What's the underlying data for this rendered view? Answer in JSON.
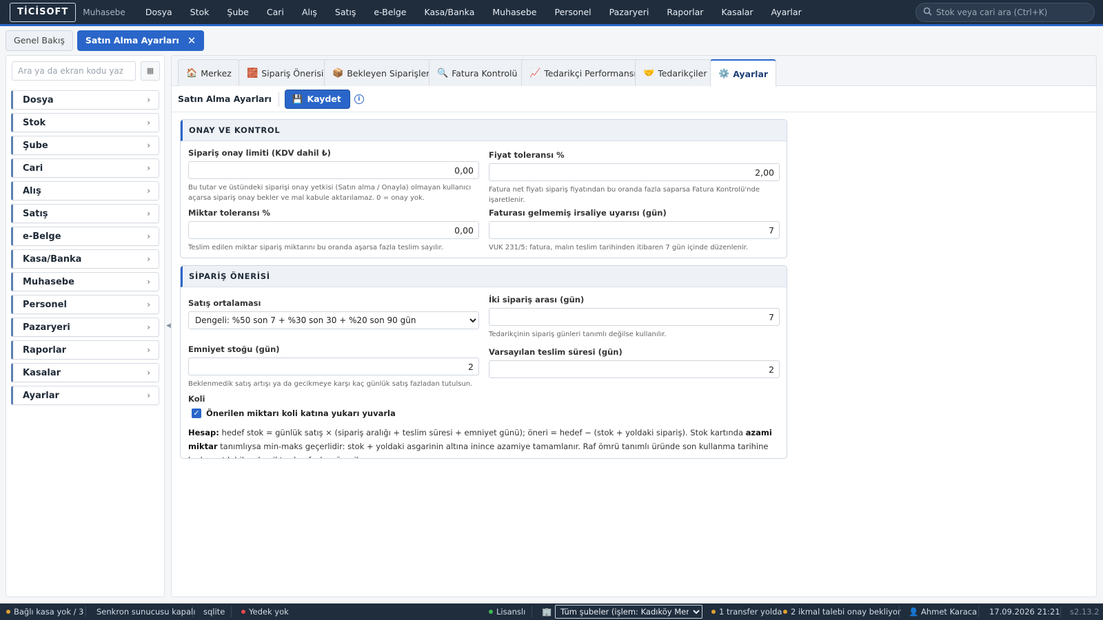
{
  "app": {
    "logo": "TİCİSOFT",
    "module": "Muhasebe"
  },
  "topmenu": [
    "Dosya",
    "Stok",
    "Şube",
    "Cari",
    "Alış",
    "Satış",
    "e-Belge",
    "Kasa/Banka",
    "Muhasebe",
    "Personel",
    "Pazaryeri",
    "Raporlar",
    "Kasalar",
    "Ayarlar"
  ],
  "topsearch": {
    "placeholder": "Stok veya cari ara (Ctrl+K)"
  },
  "page_tabs": {
    "overview": "Genel Bakış",
    "active": "Satın Alma Ayarları"
  },
  "sidebar": {
    "search_placeholder": "Ara ya da ekran kodu yaz",
    "items": [
      "Dosya",
      "Stok",
      "Şube",
      "Cari",
      "Alış",
      "Satış",
      "e-Belge",
      "Kasa/Banka",
      "Muhasebe",
      "Personel",
      "Pazaryeri",
      "Raporlar",
      "Kasalar",
      "Ayarlar"
    ]
  },
  "module_tabs": [
    {
      "label": "Merkez",
      "icon": "home-icon"
    },
    {
      "label": "Sipariş Önerisi",
      "icon": "bricks-icon"
    },
    {
      "label": "Bekleyen Siparişler",
      "icon": "package-icon"
    },
    {
      "label": "Fatura Kontrolü",
      "icon": "magnifier-icon"
    },
    {
      "label": "Tedarikçi Performansı",
      "icon": "chart-icon"
    },
    {
      "label": "Tedarikçiler",
      "icon": "handshake-icon"
    },
    {
      "label": "Ayarlar",
      "icon": "gear-icon"
    }
  ],
  "toolbar": {
    "title": "Satın Alma Ayarları",
    "save_label": "Kaydet"
  },
  "approval": {
    "title": "ONAY VE KONTROL",
    "limit_label": "Sipariş onay limiti (KDV dahil ₺)",
    "limit_value": "0,00",
    "limit_hint": "Bu tutar ve üstündeki siparişi onay yetkisi (Satın alma / Onayla) olmayan kullanıcı açarsa sipariş onay bekler ve mal kabule aktarılamaz. 0 = onay yok.",
    "price_tol_label": "Fiyat toleransı %",
    "price_tol_value": "2,00",
    "price_tol_hint": "Fatura net fiyatı sipariş fiyatından bu oranda fazla saparsa Fatura Kontrolü'nde işaretlenir.",
    "qty_tol_label": "Miktar toleransı %",
    "qty_tol_value": "0,00",
    "qty_tol_hint": "Teslim edilen miktar sipariş miktarını bu oranda aşarsa fazla teslim sayılır.",
    "waybill_label": "Faturası gelmemiş irsaliye uyarısı (gün)",
    "waybill_value": "7",
    "waybill_hint": "VUK 231/5: fatura, malın teslim tarihinden itibaren 7 gün içinde düzenlenir."
  },
  "suggestion": {
    "title": "SİPARİŞ ÖNERİSİ",
    "avg_label": "Satış ortalaması",
    "avg_value": "Dengeli: %50 son 7 + %30 son 30 + %20 son 90 gün",
    "interval_label": "İki sipariş arası (gün)",
    "interval_value": "7",
    "interval_hint": "Tedarikçinin sipariş günleri tanımlı değilse kullanılır.",
    "safety_label": "Emniyet stoğu (gün)",
    "safety_value": "2",
    "safety_hint": "Beklenmedik satış artışı ya da gecikmeye karşı kaç günlük satış fazladan tutulsun.",
    "lead_label": "Varsayılan teslim süresi (gün)",
    "lead_value": "2",
    "koli_label": "Koli",
    "koli_checkbox": "Önerilen miktarı koli katına yukarı yuvarla",
    "koli_checked": true,
    "note_bold1": "Hesap:",
    "note_text1": " hedef stok = günlük satış × (sipariş aralığı + teslim süresi + emniyet günü); öneri = hedef − (stok + yoldaki sipariş). Stok kartında ",
    "note_bold2": "azami miktar",
    "note_text2": " tanımlıysa min-maks geçerlidir: stok + yoldaki asgarinin altına inince azamiye tamamlanır. Raf ömrü tanımlı üründe son kullanma tarihine kadar satılabilecek miktardan fazlası önerilmez."
  },
  "statusbar": {
    "cash": "Bağlı kasa yok / 3",
    "sync": "Senkron sunucusu kapalı",
    "db": "sqlite",
    "backup": "Yedek yok",
    "license": "Lisanslı",
    "branch": "Tüm şubeler (işlem: Kadıköy Merkez)",
    "transfer": "1 transfer yolda",
    "supply": "2 ikmal talebi onay bekliyor",
    "user": "Ahmet Karaca",
    "datetime": "17.09.2026 21:21",
    "version": "s2.13.2"
  },
  "colors": {
    "accent": "#2a66c9",
    "topbar": "#1f2d3d",
    "ok": "#3fb950",
    "warn": "#e0a030",
    "err": "#e5484d"
  }
}
